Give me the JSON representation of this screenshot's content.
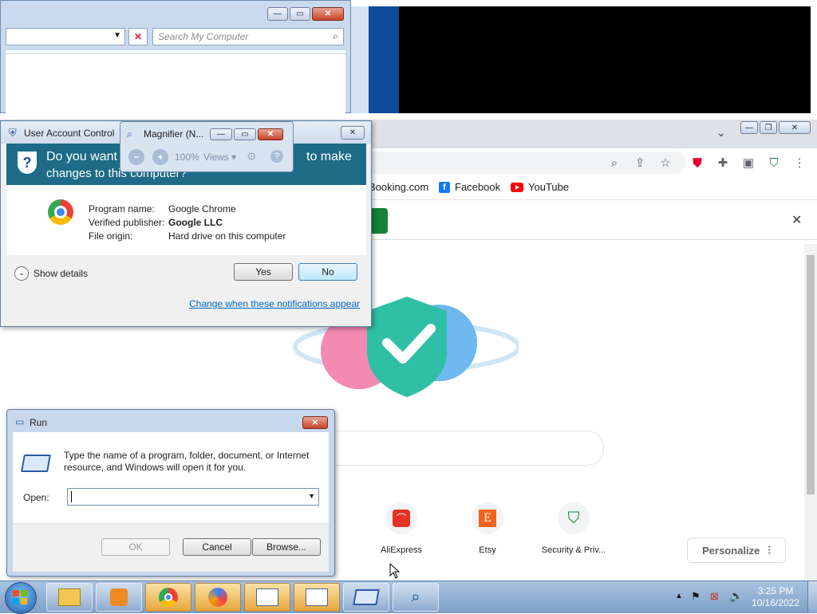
{
  "explorer": {
    "search_placeholder": "Search My Computer"
  },
  "chrome": {
    "bookmarks": [
      {
        "label": "Booking.com",
        "icon": "booking-icon"
      },
      {
        "label": "Facebook",
        "icon": "facebook-icon"
      },
      {
        "label": "YouTube",
        "icon": "youtube-icon"
      }
    ],
    "shortcuts": [
      {
        "label": "AliExpress",
        "icon": "aliexpress-icon",
        "color": "#e43225"
      },
      {
        "label": "Etsy",
        "icon": "etsy-icon",
        "color": "#f1641e"
      },
      {
        "label": "Security & Priv...",
        "icon": "shield-check-icon",
        "color": "#188038"
      }
    ],
    "personalize_label": "Personalize"
  },
  "uac": {
    "title": "User Account Control",
    "banner_text_line1": "Do you want",
    "banner_text_line1b": "to make",
    "banner_text_line2": "changes to this computer?",
    "program_name_label": "Program name:",
    "program_name_value": "Google Chrome",
    "publisher_label": "Verified publisher:",
    "publisher_value": "Google LLC",
    "origin_label": "File origin:",
    "origin_value": "Hard drive on this computer",
    "show_details_label": "Show details",
    "yes_label": "Yes",
    "no_label": "No",
    "change_link": "Change when these notifications appear"
  },
  "magnifier": {
    "title": "Magnifier (N...",
    "zoom": "100%",
    "views_label": "Views"
  },
  "run": {
    "title": "Run",
    "description": "Type the name of a program, folder, document, or Internet resource, and Windows will open it for you.",
    "open_label": "Open:",
    "open_value": "",
    "ok_label": "OK",
    "cancel_label": "Cancel",
    "browse_label": "Browse..."
  },
  "taskbar": {
    "time": "3:25 PM",
    "date": "10/16/2022",
    "items": [
      "explorer-icon",
      "media-player-icon",
      "chrome-icon",
      "security-app-icon",
      "document-window-icon",
      "document-window-icon",
      "run-dialog-icon",
      "magnifier-icon"
    ]
  }
}
